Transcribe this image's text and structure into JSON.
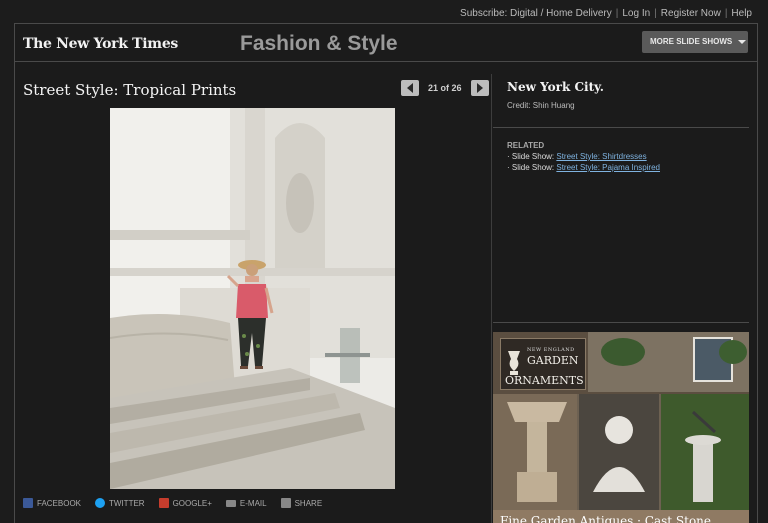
{
  "toplinks": {
    "subscribe": "Subscribe: Digital / Home Delivery",
    "login": "Log In",
    "register": "Register Now",
    "help": "Help"
  },
  "header": {
    "logo": "The New York Times",
    "section": "Fashion & Style",
    "more_slideshows": "MORE SLIDE SHOWS"
  },
  "slideshow": {
    "title": "Street Style: Tropical Prints",
    "counter": "21 of 26"
  },
  "caption": {
    "title": "New York City.",
    "credit": "Credit: Shin Huang"
  },
  "related": {
    "heading": "RELATED",
    "items": [
      {
        "prefix": "Slide Show:",
        "link": "Street Style: Shirtdresses"
      },
      {
        "prefix": "Slide Show:",
        "link": "Street Style: Pajama Inspired"
      }
    ]
  },
  "share": {
    "facebook": "FACEBOOK",
    "twitter": "TWITTER",
    "google": "GOOGLE+",
    "email": "E-MAIL",
    "share": "SHARE"
  },
  "ad": {
    "small": "NEW ENGLAND",
    "line1": "GARDEN",
    "line2": "ORNAMENTS",
    "footer": "Fine Garden Antiques · Cast Stone"
  },
  "colors": {
    "background": "#1c1c1c",
    "link": "#7fb3e0",
    "facebook": "#3b5998",
    "twitter": "#1da1f2",
    "google": "#c63d2d"
  }
}
